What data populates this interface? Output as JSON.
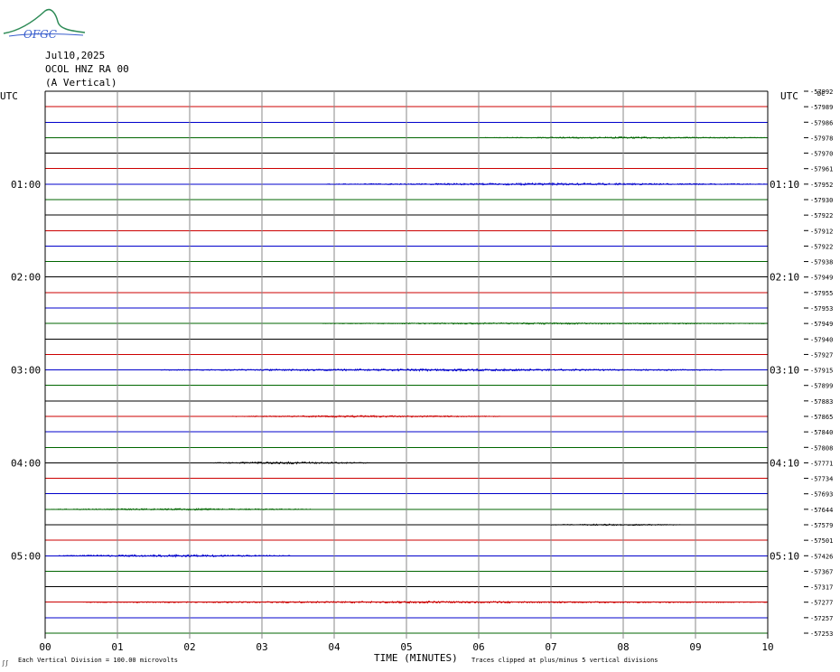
{
  "header": {
    "logo_text": "OFGC",
    "date": "Jul10,2025",
    "station": "OCOL HNZ RA 00",
    "component": "(A Vertical)"
  },
  "axis": {
    "left_label": "UTC",
    "right_label": "UTC",
    "xlabel": "TIME (MINUTES)",
    "footer_left": "Each Vertical Division =  100.00 microvolts",
    "footer_right": "Traces clipped at plus/minus 5 vertical divisions",
    "footer_corner": "ʃʃ",
    "dc_label": "DC"
  },
  "chart_data": {
    "type": "line",
    "title": "",
    "xlabel": "TIME (MINUTES)",
    "xlim": [
      0,
      10
    ],
    "x_ticks": [
      "00",
      "01",
      "02",
      "03",
      "04",
      "05",
      "06",
      "07",
      "08",
      "09",
      "10"
    ],
    "row_colors": [
      "#000000",
      "#cc0000",
      "#0000cc",
      "#006600"
    ],
    "left_time_labels": [
      {
        "row": 6,
        "label": "01:00"
      },
      {
        "row": 12,
        "label": "02:00"
      },
      {
        "row": 18,
        "label": "03:00"
      },
      {
        "row": 24,
        "label": "04:00"
      },
      {
        "row": 30,
        "label": "05:00"
      }
    ],
    "right_time_labels": [
      {
        "row": 6,
        "label": "01:10"
      },
      {
        "row": 12,
        "label": "02:10"
      },
      {
        "row": 18,
        "label": "03:10"
      },
      {
        "row": 24,
        "label": "04:10"
      },
      {
        "row": 30,
        "label": "05:10"
      }
    ],
    "dc_offsets": [
      "-57992",
      "-57989",
      "-57986",
      "-57978",
      "-57970",
      "-57961",
      "-57952",
      "-57930",
      "-57922",
      "-57912",
      "-57922",
      "-57938",
      "-57949",
      "-57955",
      "-57953",
      "-57949",
      "-57940",
      "-57927",
      "-57915",
      "-57899",
      "-57883",
      "-57865",
      "-57840",
      "-57808",
      "-57771",
      "-57734",
      "-57693",
      "-57644",
      "-57579",
      "-57501",
      "-57426",
      "-57367",
      "-57317",
      "-57277",
      "-57257",
      "-57253"
    ],
    "activity": [
      {
        "row": 3,
        "start": 6.1,
        "end": 10.0,
        "amp": 0.9
      },
      {
        "row": 6,
        "start": 3.9,
        "end": 10.0,
        "amp": 1.2
      },
      {
        "row": 15,
        "start": 3.8,
        "end": 10.0,
        "amp": 0.9
      },
      {
        "row": 18,
        "start": 1.6,
        "end": 9.4,
        "amp": 1.3
      },
      {
        "row": 21,
        "start": 2.6,
        "end": 6.3,
        "amp": 1.1
      },
      {
        "row": 24,
        "start": 2.3,
        "end": 4.5,
        "amp": 1.2
      },
      {
        "row": 27,
        "start": 0.1,
        "end": 3.7,
        "amp": 1.0
      },
      {
        "row": 28,
        "start": 7.0,
        "end": 8.8,
        "amp": 0.9
      },
      {
        "row": 30,
        "start": 0.2,
        "end": 3.4,
        "amp": 1.3
      },
      {
        "row": 33,
        "start": 0.5,
        "end": 10.0,
        "amp": 1.1
      }
    ]
  }
}
